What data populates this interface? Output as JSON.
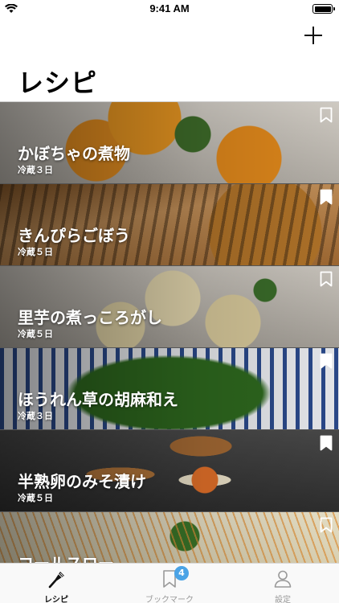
{
  "status_bar": {
    "time": "9:41 AM"
  },
  "header": {
    "title": "レシピ",
    "add_icon": "plus-icon"
  },
  "recipes": [
    {
      "title": "かぼちゃの煮物",
      "storage": "冷蔵３日",
      "bookmarked": false
    },
    {
      "title": "きんぴらごぼう",
      "storage": "冷蔵５日",
      "bookmarked": true
    },
    {
      "title": "里芋の煮っころがし",
      "storage": "冷蔵５日",
      "bookmarked": false
    },
    {
      "title": "ほうれん草の胡麻和え",
      "storage": "冷蔵３日",
      "bookmarked": true
    },
    {
      "title": "半熟卵のみそ漬け",
      "storage": "冷蔵５日",
      "bookmarked": true
    },
    {
      "title": "コールスロー",
      "storage": "",
      "bookmarked": false
    }
  ],
  "tab_bar": {
    "recipes": {
      "label": "レシピ",
      "icon": "spatula-icon"
    },
    "bookmarks": {
      "label": "ブックマーク",
      "badge": "4",
      "icon": "bookmark-icon"
    },
    "settings": {
      "label": "設定",
      "icon": "person-icon"
    }
  },
  "colors": {
    "badge": "#4aa3e6",
    "active_tab": "#111111",
    "inactive_tab": "#999999"
  }
}
